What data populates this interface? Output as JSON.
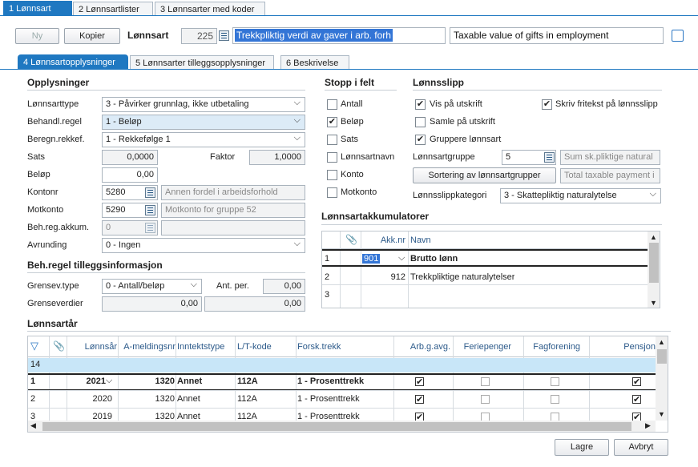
{
  "top_tabs": [
    "1 Lønnsart",
    "2 Lønnsartlister",
    "3 Lønnsarter med koder"
  ],
  "toolbar": {
    "new_label": "Ny",
    "copy_label": "Kopier",
    "lonnsart_label": "Lønnsart",
    "lonnsart_nr": "225",
    "name_no": "Trekkpliktig verdi av gaver i arb. forh",
    "name_en": "Taxable value of gifts in employment"
  },
  "sub_tabs": [
    "4 Lønnsartopplysninger",
    "5 Lønnsarter tilleggsopplysninger",
    "6 Beskrivelse"
  ],
  "opp": {
    "title": "Opplysninger",
    "lonnsarttype_label": "Lønnsarttype",
    "lonnsarttype": "3 - Påvirker grunnlag, ikke utbetaling",
    "behandl_label": "Behandl.regel",
    "behandl": "1 - Beløp",
    "beregn_label": "Beregn.rekkef.",
    "beregn": "1 - Rekkefølge 1",
    "sats_label": "Sats",
    "sats": "0,0000",
    "faktor_label": "Faktor",
    "faktor": "1,0000",
    "belop_label": "Beløp",
    "belop": "0,00",
    "kontonr_label": "Kontonr",
    "kontonr": "5280",
    "kontonr_desc": "Annen fordel i arbeidsforhold",
    "motkonto_label": "Motkonto",
    "motkonto": "5290",
    "motkonto_desc": "Motkonto for gruppe 52",
    "behreg_label": "Beh.reg.akkum.",
    "behreg": "0",
    "avrunding_label": "Avrunding",
    "avrunding": "0 - Ingen"
  },
  "beh": {
    "title": "Beh.regel tilleggsinformasjon",
    "grensev_label": "Grensev.type",
    "grensev": "0 - Antall/beløp",
    "antper_label": "Ant. per.",
    "antper": "0,00",
    "grenseverdier_label": "Grenseverdier",
    "gv1": "0,00",
    "gv2": "0,00"
  },
  "stopp": {
    "title": "Stopp i felt",
    "items": [
      {
        "label": "Antall",
        "checked": false
      },
      {
        "label": "Beløp",
        "checked": true
      },
      {
        "label": "Sats",
        "checked": false
      },
      {
        "label": "Lønnsartnavn",
        "checked": false
      },
      {
        "label": "Konto",
        "checked": false
      },
      {
        "label": "Motkonto",
        "checked": false
      }
    ]
  },
  "slipp": {
    "title": "Lønnsslipp",
    "vis": "Vis på utskrift",
    "samle": "Samle på utskrift",
    "gruppere": "Gruppere lønnsart",
    "skriv": "Skriv fritekst på lønnsslipp",
    "gruppe_label": "Lønnsartgruppe",
    "gruppe": "5",
    "gruppe_desc": "Sum sk.pliktige natural",
    "sort_btn": "Sortering av lønnsartgrupper",
    "total_desc": "Total taxable payment i",
    "kat_label": "Lønnsslippkategori",
    "kat": "3 - Skattepliktig naturalytelse"
  },
  "akk": {
    "title": "Lønnsartakkumulatorer",
    "col_akknr": "Akk.nr",
    "col_navn": "Navn",
    "rows": [
      {
        "n": "1",
        "akk": "901",
        "navn": "Brutto lønn"
      },
      {
        "n": "2",
        "akk": "912",
        "navn": "Trekkpliktige naturalytelser"
      },
      {
        "n": "3",
        "akk": "",
        "navn": ""
      }
    ]
  },
  "lar": {
    "title": "Lønnsartår",
    "columns": [
      "Lønnsår",
      "A-meldingsnr",
      "Inntektstype",
      "L/T-kode",
      "Forsk.trekk",
      "Arb.g.avg.",
      "Feriepenger",
      "Fagforening",
      "Pensjon"
    ],
    "new_row": "14",
    "rows": [
      {
        "n": "1",
        "ar": "2021",
        "am": "1320",
        "it": "Annet",
        "lt": "112A",
        "fo": "1 - Prosenttrekk"
      },
      {
        "n": "2",
        "ar": "2020",
        "am": "1320",
        "it": "Annet",
        "lt": "112A",
        "fo": "1 - Prosenttrekk"
      },
      {
        "n": "3",
        "ar": "2019",
        "am": "1320",
        "it": "Annet",
        "lt": "112A",
        "fo": "1 - Prosenttrekk"
      }
    ]
  },
  "footer": {
    "save": "Lagre",
    "cancel": "Avbryt"
  }
}
